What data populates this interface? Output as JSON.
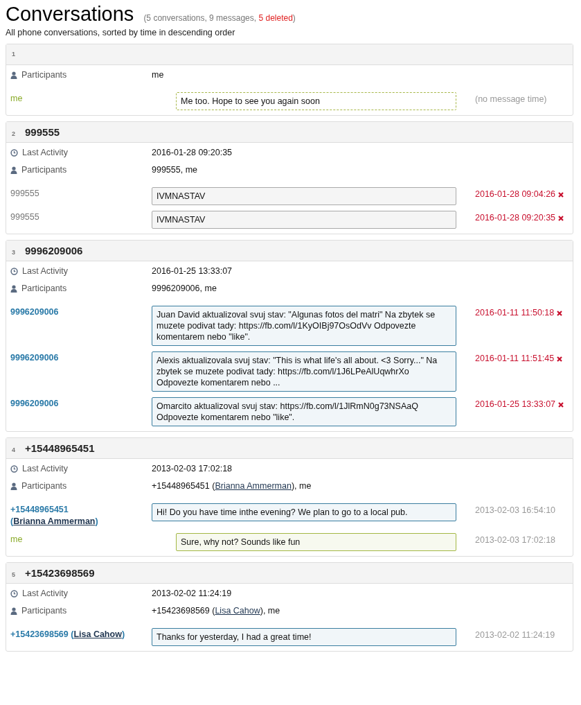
{
  "title": "Conversations",
  "summary": {
    "prefix": "(5 conversations, 9 messages, ",
    "deleted": "5 deleted",
    "suffix": ")"
  },
  "subtitle": "All phone conversations, sorted by time in descending order",
  "conversations": [
    {
      "index": "1",
      "fields": [
        {
          "kind": "participants",
          "label": "Participants",
          "value": {
            "before": "me"
          }
        }
      ],
      "messages": [
        {
          "kind": "draft",
          "sender": "me",
          "text": "Me too. Hope to see you again soon",
          "time": "(no message time)",
          "deleted": false
        }
      ]
    },
    {
      "index": "2",
      "name": "999555",
      "fields": [
        {
          "kind": "activity",
          "label": "Last Activity",
          "value": {
            "before": "2016-01-28 09:20:35"
          }
        },
        {
          "kind": "participants",
          "label": "Participants",
          "value": {
            "before": "999555, me"
          }
        }
      ],
      "messages": [
        {
          "kind": "unknown",
          "sender": "999555",
          "text": "IVMNASTAV",
          "time": "2016-01-28 09:04:26",
          "deleted": true
        },
        {
          "kind": "unknown",
          "sender": "999555",
          "text": "IVMNASTAV",
          "time": "2016-01-28 09:20:35",
          "deleted": true
        }
      ]
    },
    {
      "index": "3",
      "name": "9996209006",
      "fields": [
        {
          "kind": "activity",
          "label": "Last Activity",
          "value": {
            "before": "2016-01-25 13:33:07"
          }
        },
        {
          "kind": "participants",
          "label": "Participants",
          "value": {
            "before": "9996209006, me"
          }
        }
      ],
      "messages": [
        {
          "kind": "incoming",
          "sender": "9996209006",
          "text": "Juan David aktualizoval svuj stav: \"Algunas fotos del matri\" Na zbytek se muzete podivat tady: https://fb.com/l/1KyOIBj97OsOdVv Odpovezte komentarem nebo \"like\".",
          "time": "2016-01-11 11:50:18",
          "deleted": true
        },
        {
          "kind": "incoming",
          "sender": "9996209006",
          "text": "Alexis aktualizovala svuj stav: \"This is what life's all about. <3 Sorry...\" Na zbytek se muzete podivat tady: https://fb.com/l/1J6LPeAlUqwhrXo Odpovezte komentarem nebo ...",
          "time": "2016-01-11 11:51:45",
          "deleted": true
        },
        {
          "kind": "incoming",
          "sender": "9996209006",
          "text": "Omarcito aktualizoval svuj stav: https://fb.com/l/1JlRmN0g73NSAaQ Odpovezte komentarem nebo \"like\".",
          "time": "2016-01-25 13:33:07",
          "deleted": true
        }
      ]
    },
    {
      "index": "4",
      "name": "+15448965451",
      "fields": [
        {
          "kind": "activity",
          "label": "Last Activity",
          "value": {
            "before": "2013-02-03 17:02:18"
          }
        },
        {
          "kind": "participants",
          "label": "Participants",
          "value": {
            "before": "+15448965451 (",
            "contact": "Brianna Ammerman",
            "after": "), me"
          }
        }
      ],
      "messages": [
        {
          "kind": "incoming",
          "sender": "+15448965451 (",
          "contact": "Brianna Ammerman",
          "after": ")",
          "text": "Hi! Do you have time inthe evening? We plan to go to a local pub.",
          "time": "2013-02-03 16:54:10",
          "deleted": false
        },
        {
          "kind": "outgoing",
          "sender": "me",
          "text": "Sure, why not? Sounds like fun",
          "time": "2013-02-03 17:02:18",
          "deleted": false
        }
      ]
    },
    {
      "index": "5",
      "name": "+15423698569",
      "fields": [
        {
          "kind": "activity",
          "label": "Last Activity",
          "value": {
            "before": "2013-02-02 11:24:19"
          }
        },
        {
          "kind": "participants",
          "label": "Participants",
          "value": {
            "before": "+15423698569 (",
            "contact": "Lisa Cahow",
            "after": "), me"
          }
        }
      ],
      "messages": [
        {
          "kind": "incoming",
          "sender": "+15423698569 (",
          "contact": "Lisa Cahow",
          "after": ")",
          "text": "Thanks for yesterday, I had a great time!",
          "time": "2013-02-02 11:24:19",
          "deleted": false
        }
      ]
    }
  ]
}
